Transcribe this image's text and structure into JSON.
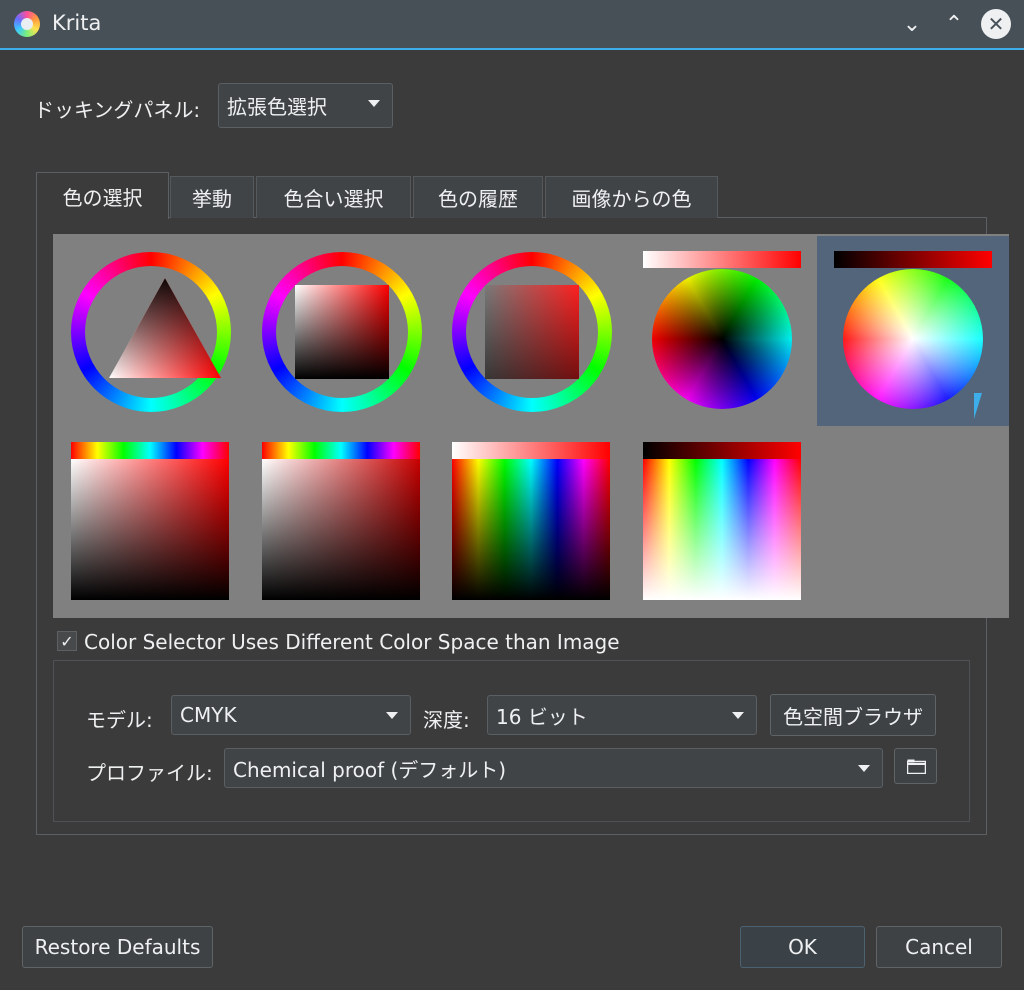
{
  "window": {
    "title": "Krita"
  },
  "docking": {
    "label": "ドッキングパネル:",
    "value": "拡張色選択"
  },
  "tabs": [
    {
      "label": "色の選択"
    },
    {
      "label": "挙動"
    },
    {
      "label": "色合い選択"
    },
    {
      "label": "色の履歴"
    },
    {
      "label": "画像からの色"
    }
  ],
  "color_space": {
    "checkbox_label": "Color Selector Uses Different Color Space than Image",
    "checked": true,
    "model_label": "モデル:",
    "model_value": "CMYK",
    "depth_label": "深度:",
    "depth_value": "16 ビット",
    "browser_button": "色空間ブラウザ",
    "profile_label": "プロファイル:",
    "profile_value": "Chemical proof (デフォルト)"
  },
  "footer": {
    "restore": "Restore Defaults",
    "ok": "OK",
    "cancel": "Cancel"
  },
  "colors": {
    "accent": "#3daee9",
    "background": "#3b3b3b",
    "titlebar": "#475057",
    "selector_bg": "#808080",
    "selection": "#52657a"
  },
  "icons": [
    "krita-app-icon",
    "minimize-icon",
    "maximize-icon",
    "close-icon",
    "folder-icon",
    "mouse-cursor-icon"
  ]
}
